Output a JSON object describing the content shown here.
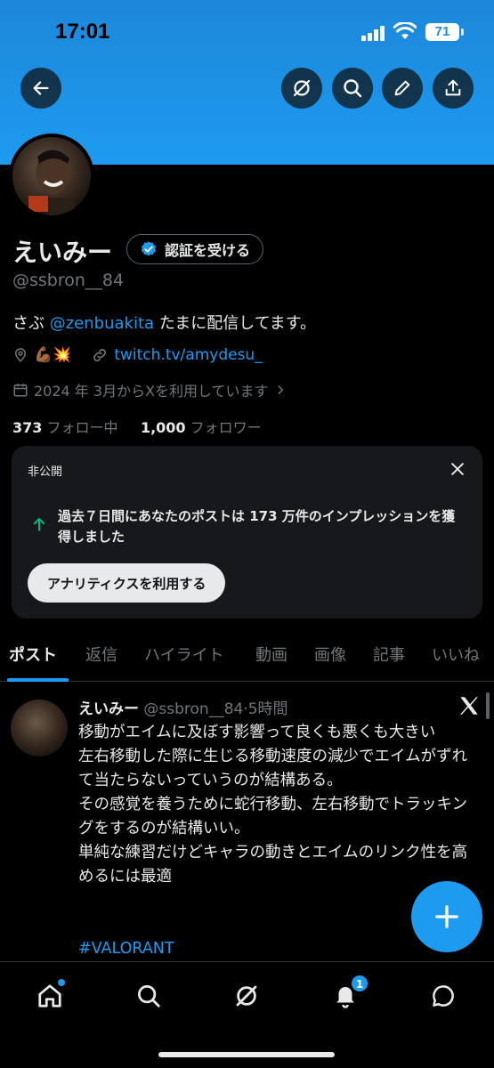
{
  "status_bar": {
    "time": "17:01",
    "battery": "71"
  },
  "profile": {
    "name": "えいみー",
    "verify_button": "認証を受ける",
    "handle": "@ssbron__84",
    "bio_prefix": "さぶ ",
    "bio_mention": "@zenbuakita",
    "bio_suffix": " たまに配信してます。",
    "location_emoji": "💪🏾💥",
    "website": "twitch.tv/amydesu_",
    "joined": "2024 年 3月からXを利用しています",
    "following_count": "373",
    "following_label": "フォロー中",
    "followers_count": "1,000",
    "followers_label": "フォロワー"
  },
  "insight_card": {
    "label": "非公開",
    "message": "過去７日間にあなたのポストは 173 万件のインプレッションを獲得しました",
    "button": "アナリティクスを利用する"
  },
  "tabs": [
    "ポスト",
    "返信",
    "ハイライト",
    "動画",
    "画像",
    "記事",
    "いいね"
  ],
  "post": {
    "name": "えいみー",
    "meta": "@ssbron__84·5時間",
    "body": "移動がエイムに及ぼす影響って良くも悪くも大きい\n左右移動した際に生じる移動速度の減少でエイムがずれて当たらないっていうのが結構ある。\nその感覚を養うために蛇行移動、左右移動でトラッキングをするのが結構いい。\n単純な練習だけどキャラの動きとエイムのリンク性を高めるには最適",
    "hashtag": "#VALORANT"
  },
  "bottom_nav": {
    "notifications_badge": "1"
  },
  "colors": {
    "accent": "#1d9bf0",
    "background": "#000000",
    "muted": "#71767b"
  }
}
